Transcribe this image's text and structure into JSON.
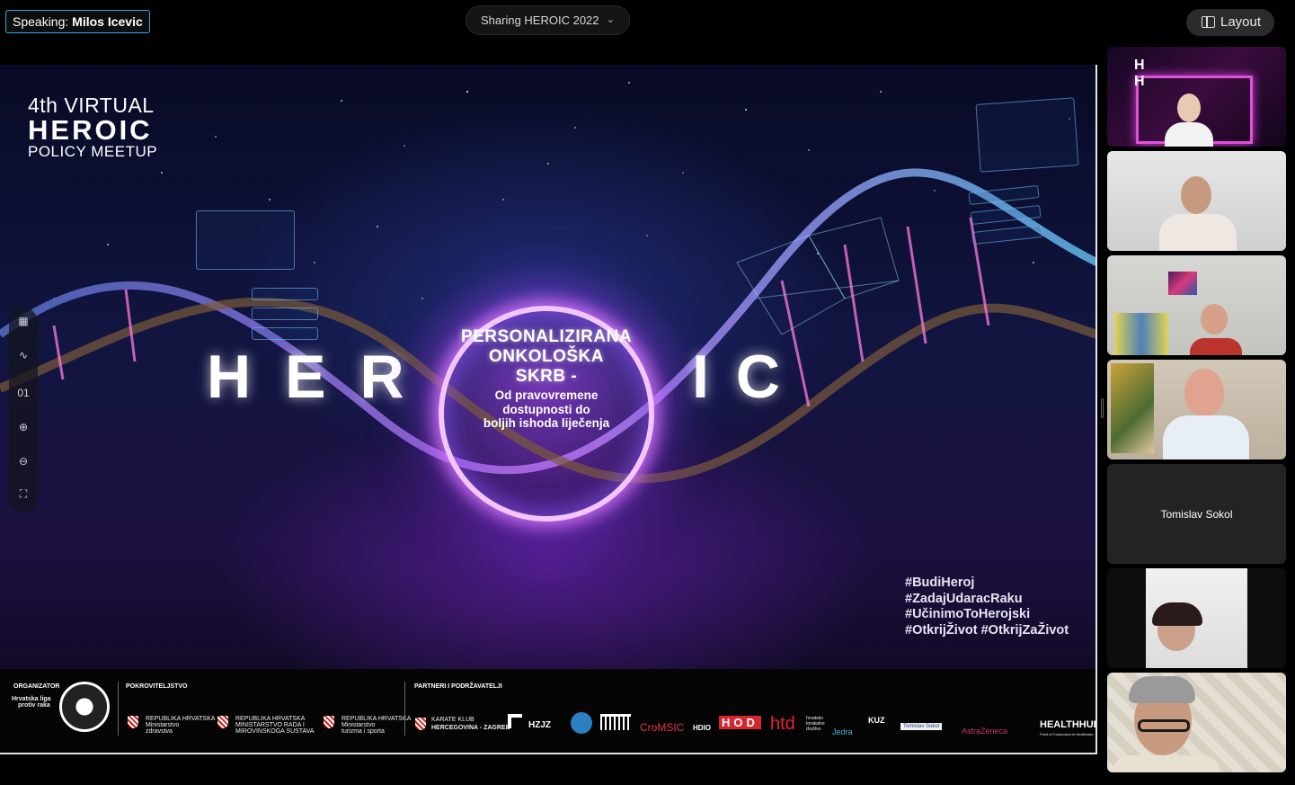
{
  "topbar": {
    "speaking_label": "Speaking:",
    "speaker_name": "Milos Icevic",
    "sharing_text": "Sharing HEROIC 2022",
    "layout_label": "Layout"
  },
  "slide": {
    "brand": {
      "line1": "4th VIRTUAL",
      "line2": "HEROIC",
      "line3": "POLICY MEETUP"
    },
    "big_left": "HER",
    "big_right": "IC",
    "ring_title_1": "PERSONALIZIRANA",
    "ring_title_2": "ONKOLOŠKA",
    "ring_title_3": "SKRB -",
    "ring_sub_1": "Od pravovremene",
    "ring_sub_2": "dostupnosti do",
    "ring_sub_3": "boljih ishoda liječenja",
    "hashtags": [
      "#BudiHeroj",
      "#ZadajUdaracRaku",
      "#UčinimoToHerojski",
      "#OtkrijŽivot #OtkrijZaŽivot"
    ],
    "toolbar": {
      "page_number": "01"
    }
  },
  "sponsors": {
    "organizator_head": "ORGANIZATOR",
    "organizator_name": [
      "Hrvatska liga",
      "protiv raka"
    ],
    "pokrovitelj_head": "POKROVITELJSTVO",
    "pokrovitelji": [
      [
        "REPUBLIKA HRVATSKA",
        "Ministarstvo",
        "zdravstva"
      ],
      [
        "REPUBLIKA HRVATSKA",
        "MINISTARSTVO RADA I",
        "MIROVINSKOGA SUSTAVA"
      ],
      [
        "REPUBLIKA HRVATSKA",
        "Ministarstvo",
        "turizma i sporta"
      ]
    ],
    "partneri_head": "PARTNERI I PODRŽAVATELJI",
    "partneri": {
      "karate": [
        "KARATE KLUB",
        "HERCEGOVINA - ZAGREB"
      ],
      "hzjz": "HZJZ",
      "cromsic": "CroMSIC",
      "hdio": "HDIO",
      "hod": "HOD",
      "htd": "htd",
      "htd_sub": [
        "hrvatsko",
        "torakalno",
        "društvo"
      ],
      "jedra": "Jedra",
      "kuz": "KUZ",
      "tomislav": "Tomislav Sokol",
      "astrazeneca": "AstraZeneca",
      "healthhub": "HEALTHHUB",
      "healthhub_sub": "Point of Connection in Healthcare"
    }
  },
  "participants": [
    {
      "name": ""
    },
    {
      "name": ""
    },
    {
      "name": ""
    },
    {
      "name": ""
    },
    {
      "name": "Tomislav Sokol"
    },
    {
      "name": ""
    },
    {
      "name": ""
    }
  ]
}
